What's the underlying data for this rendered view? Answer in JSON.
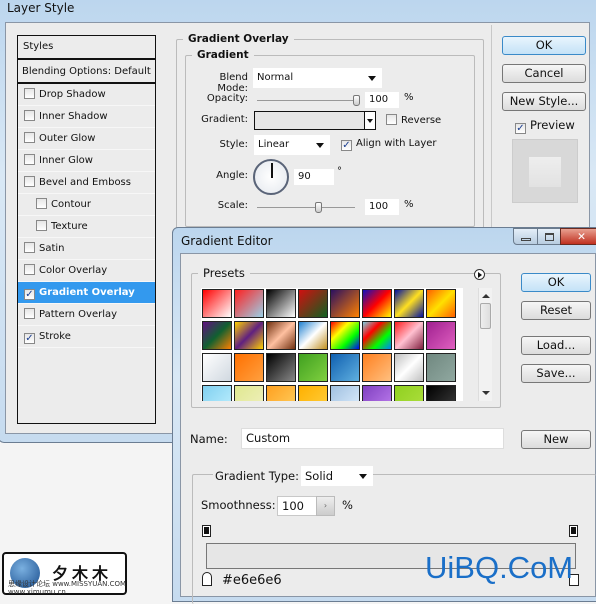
{
  "layer_style": {
    "title": "Layer Style",
    "styles_header": "Styles",
    "blending": "Blending Options: Default",
    "items": [
      {
        "label": "Drop Shadow",
        "checked": false,
        "indent": false
      },
      {
        "label": "Inner Shadow",
        "checked": false,
        "indent": false
      },
      {
        "label": "Outer Glow",
        "checked": false,
        "indent": false
      },
      {
        "label": "Inner Glow",
        "checked": false,
        "indent": false
      },
      {
        "label": "Bevel and Emboss",
        "checked": false,
        "indent": false
      },
      {
        "label": "Contour",
        "checked": false,
        "indent": true
      },
      {
        "label": "Texture",
        "checked": false,
        "indent": true
      },
      {
        "label": "Satin",
        "checked": false,
        "indent": false
      },
      {
        "label": "Color Overlay",
        "checked": false,
        "indent": false
      },
      {
        "label": "Gradient Overlay",
        "checked": true,
        "indent": false,
        "selected": true
      },
      {
        "label": "Pattern Overlay",
        "checked": false,
        "indent": false
      },
      {
        "label": "Stroke",
        "checked": true,
        "indent": false
      }
    ],
    "section_title": "Gradient Overlay",
    "group_title": "Gradient",
    "blend_mode_label": "Blend Mode:",
    "blend_mode": "Normal",
    "opacity_label": "Opacity:",
    "opacity": "100",
    "opacity_percent": 100,
    "pct": "%",
    "gradient_label": "Gradient:",
    "reverse_label": "Reverse",
    "reverse": false,
    "style_label": "Style:",
    "style": "Linear",
    "align_label": "Align with Layer",
    "align": true,
    "angle_label": "Angle:",
    "angle": "90",
    "degree": "°",
    "scale_label": "Scale:",
    "scale": "100",
    "scale_percent": 100,
    "ok": "OK",
    "cancel": "Cancel",
    "new_style": "New Style...",
    "preview_label": "Preview",
    "preview": true
  },
  "gradient_editor": {
    "title": "Gradient Editor",
    "presets_label": "Presets",
    "ok": "OK",
    "reset": "Reset",
    "load": "Load...",
    "save": "Save...",
    "name_label": "Name:",
    "name_value": "Custom",
    "new": "New",
    "type_label": "Gradient Type:",
    "type": "Solid",
    "smoothness_label": "Smoothness:",
    "smoothness": "100",
    "pct": "%",
    "stop_color": "#e6e6e6",
    "gradient_colors": [
      "#e6e6e6",
      "#e6e6e6"
    ],
    "swatches": [
      [
        "#ff0000",
        "#ffffff"
      ],
      [
        "#ff2020",
        "#9ad0e8"
      ],
      [
        "#000000",
        "#ffffff"
      ],
      [
        "#d01010",
        "#106020"
      ],
      [
        "#2a1060",
        "#ff8000"
      ],
      [
        "#1010c0",
        "#ff0000",
        "#ffff00"
      ],
      [
        "#0010a0",
        "#ffe020",
        "#0010a0"
      ],
      [
        "#ff6000",
        "#ffe000",
        "#ff6000"
      ],
      [
        "#601080",
        "#106030",
        "#ff8000"
      ],
      [
        "#ffd000",
        "#602080",
        "#ffd000"
      ],
      [
        "#703010",
        "#ffc0a0",
        "#703010"
      ],
      [
        "#2080d0",
        "#ffffff",
        "#c09020"
      ],
      [
        "#ff0000",
        "#ffff00",
        "#00ff00",
        "#0000ff"
      ],
      [
        "#80d0e0",
        "#ff0000",
        "#00ff00",
        "#0080ff"
      ],
      [
        "#ff2020",
        "#ffc0d0",
        "#802040"
      ],
      [
        "#a02090",
        "#e060c0"
      ],
      [
        "#ffffff",
        "#d0d8e0"
      ],
      [
        "#ff7000",
        "#ffa040"
      ],
      [
        "#000000",
        "#888888"
      ],
      [
        "#40a020",
        "#80d040"
      ],
      [
        "#1060b0",
        "#60b0e0"
      ],
      [
        "#ff8020",
        "#ffc080"
      ],
      [
        "#c0c0c0",
        "#ffffff",
        "#c0c0c0"
      ],
      [
        "#708880",
        "#90a8a0"
      ],
      [
        "#80d0f0",
        "#c0f0ff"
      ],
      [
        "#e0e890",
        "#f0f0c0"
      ],
      [
        "#ffa020",
        "#ffd060"
      ],
      [
        "#ffb000",
        "#ffd040"
      ],
      [
        "#a0c0e0",
        "#e0f0ff"
      ],
      [
        "#8040c0",
        "#c080f0"
      ],
      [
        "#90d020",
        "#b0e040"
      ],
      [
        "#000000",
        "#404040"
      ]
    ]
  },
  "watermarks": {
    "corner_logo": "夕木木",
    "corner_text": "思缘设计论坛 www.MISSYUAN.COM www.ximumu.cn",
    "site": "UiBQ.CoM"
  }
}
